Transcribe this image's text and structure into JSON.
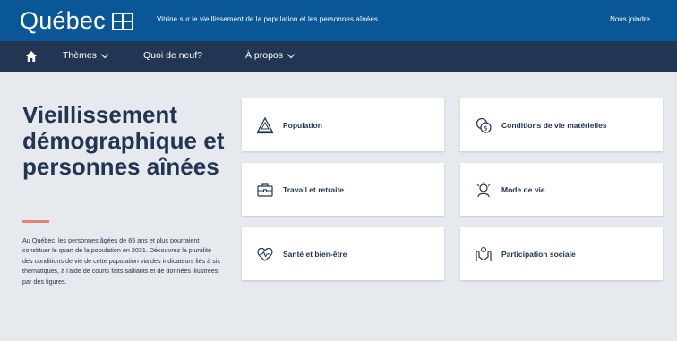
{
  "header": {
    "logo_text": "Québec",
    "site_title": "Vitrine sur le vieillissement de la population et les personnes aînées",
    "right_link": "Nous joindre"
  },
  "nav": {
    "home_icon": "home-icon",
    "items": [
      {
        "label": "Thèmes",
        "has_dropdown": true
      },
      {
        "label": "Quoi de neuf?",
        "has_dropdown": false
      },
      {
        "label": "À propos",
        "has_dropdown": true
      }
    ]
  },
  "hero": {
    "title": "Vieillissement démographique et personnes aînées",
    "description": "Au Québec, les personnes âgées de 65 ans et plus pourraient constituer le quart de la population en 2031. Découvrez la pluralité des conditions de vie de cette population via des indicateurs liés à six thématiques, à l'aide de courts faits saillants et de données illustrées par des figures."
  },
  "cards": [
    {
      "label": "Population",
      "icon": "population-icon"
    },
    {
      "label": "Conditions de vie matérielles",
      "icon": "coins-icon"
    },
    {
      "label": "Travail et retraite",
      "icon": "briefcase-icon"
    },
    {
      "label": "Mode de vie",
      "icon": "lifestyle-icon"
    },
    {
      "label": "Santé et bien-être",
      "icon": "heart-icon"
    },
    {
      "label": "Participation sociale",
      "icon": "hands-icon"
    }
  ],
  "colors": {
    "header_blue": "#095797",
    "nav_dark": "#223654",
    "page_bg": "#e6e9ee",
    "accent_underline": "#e58271"
  }
}
